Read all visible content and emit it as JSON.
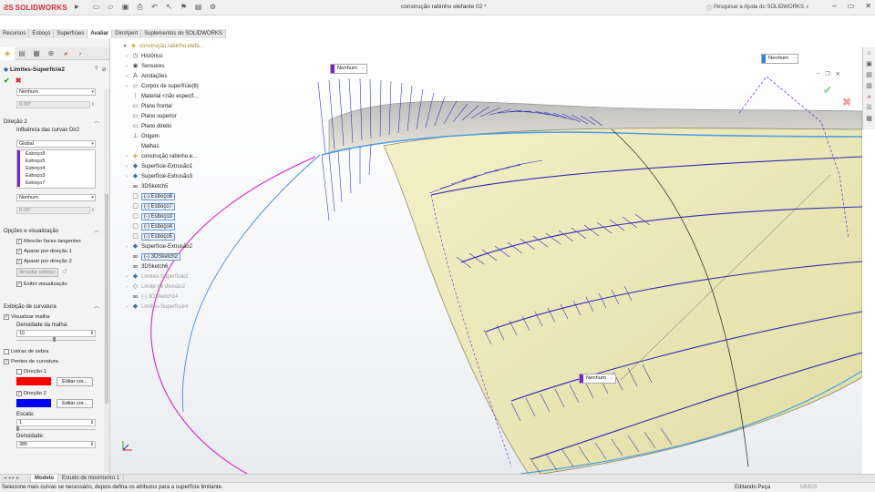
{
  "app": {
    "brand": "SOLIDWORKS",
    "document_title": "construção rabinho elefante 02 *",
    "search_placeholder": "Pesquisar a Ajuda do SOLIDWORKS"
  },
  "command_tabs": [
    "Recursos",
    "Esboço",
    "Superfícies",
    "Avaliar",
    "DimXpert",
    "Suplementos do SOLIDWORKS"
  ],
  "command_tab_active": "Avaliar",
  "property_manager": {
    "title": "Limites-Superfície2",
    "direction1_select": "Nenhum",
    "direction1_value": "0.00°",
    "direction2": {
      "header": "Direção 2",
      "influence_label": "Influência das curvas Dir2",
      "influence_select": "Global",
      "curves": [
        "Esboço8",
        "Esboço5",
        "Esboço4",
        "Esboço3",
        "Esboço7"
      ],
      "tangency_select": "Nenhum",
      "tangency_value": "0.00°"
    },
    "options": {
      "header": "Opções e visualização",
      "merge_tangent": "Mesclar faces tangentes",
      "trim_dir1": "Aparar por direção 1",
      "trim_dir2": "Aparar por direção 2",
      "drag_sketch_button": "Arrastar esboço",
      "show_preview": "Exibir visualização"
    },
    "curvature": {
      "header": "Exibição de curvatura",
      "mesh_preview": "Visualizar malha",
      "mesh_density_label": "Densidade da malha:",
      "mesh_density_value": "10",
      "zebra": "Listras de zebra",
      "combs": "Pentes de curvatura",
      "dir1": "Direção 1",
      "dir2": "Direção 2",
      "edit_color": "Editar cor...",
      "scale_label": "Escala:",
      "scale_value": "1",
      "density_label": "Densidade:",
      "density_value": "386",
      "color_dir1": "#ff0000",
      "color_dir2": "#0000ff"
    }
  },
  "feature_tree": {
    "root": "construção rabinho elefa...",
    "items": [
      {
        "label": "Histórico",
        "icon": "history-icon",
        "dim": false,
        "sel": false
      },
      {
        "label": "Sensores",
        "icon": "sensor-icon",
        "dim": false,
        "sel": false
      },
      {
        "label": "Anotações",
        "icon": "annotation-icon",
        "dim": false,
        "sel": false
      },
      {
        "label": "Corpos de superfície(8)",
        "icon": "surface-bodies-icon",
        "dim": false,
        "sel": false
      },
      {
        "label": "Material <não especif...",
        "icon": "material-icon",
        "dim": false,
        "sel": false
      },
      {
        "label": "Plano frontal",
        "icon": "plane-icon",
        "dim": false,
        "sel": false
      },
      {
        "label": "Plano superior",
        "icon": "plane-icon",
        "dim": false,
        "sel": false
      },
      {
        "label": "Plano direito",
        "icon": "plane-icon",
        "dim": false,
        "sel": false
      },
      {
        "label": "Origem",
        "icon": "origin-icon",
        "dim": false,
        "sel": false
      },
      {
        "label": "Malha1",
        "icon": "mesh-icon",
        "dim": false,
        "sel": false
      },
      {
        "label": "construção rabinho e...",
        "icon": "part-icon",
        "dim": false,
        "sel": false
      },
      {
        "label": "Superfície-Extrusão1",
        "icon": "extrude-surface-icon",
        "dim": false,
        "sel": false
      },
      {
        "label": "Superfície-Extrusão3",
        "icon": "extrude-surface-icon",
        "dim": false,
        "sel": false
      },
      {
        "label": "3DSketch5",
        "icon": "sketch3d-icon",
        "dim": false,
        "sel": false
      },
      {
        "label": "(-) Esboço8",
        "icon": "sketch-icon",
        "dim": false,
        "sel": true
      },
      {
        "label": "(-) Esboço7",
        "icon": "sketch-icon",
        "dim": false,
        "sel": true
      },
      {
        "label": "(-) Esboço3",
        "icon": "sketch-icon",
        "dim": false,
        "sel": true
      },
      {
        "label": "(-) Esboço4",
        "icon": "sketch-icon",
        "dim": false,
        "sel": true
      },
      {
        "label": "(-) Esboço5",
        "icon": "sketch-icon",
        "dim": false,
        "sel": true
      },
      {
        "label": "Superfície-Extrusão2",
        "icon": "extrude-surface-icon",
        "dim": false,
        "sel": false
      },
      {
        "label": "(-) 3DSketch2",
        "icon": "sketch3d-icon",
        "dim": false,
        "sel": true
      },
      {
        "label": "3DSketch6",
        "icon": "sketch3d-icon",
        "dim": false,
        "sel": false
      },
      {
        "label": "Limites-Superfície2",
        "icon": "boundary-surface-icon",
        "dim": true,
        "sel": false
      },
      {
        "label": "Limite de divisão2",
        "icon": "split-line-icon",
        "dim": true,
        "sel": false
      },
      {
        "label": "(-) 3DSketch14",
        "icon": "sketch3d-icon",
        "dim": true,
        "sel": false
      },
      {
        "label": "Limites-Superfície4",
        "icon": "boundary-surface-icon",
        "dim": true,
        "sel": false
      }
    ]
  },
  "viewport": {
    "callouts": [
      "Nenhum",
      "Nenhum",
      "Nenhum"
    ]
  },
  "bottom_tabs": [
    "Modelo",
    "Estudo de movimento 1"
  ],
  "status": {
    "message": "Selecione mais curvas se necessário, depois defina os atributos para a superfície limitante.",
    "mode": "Editando Peça",
    "units": "MMGS"
  }
}
